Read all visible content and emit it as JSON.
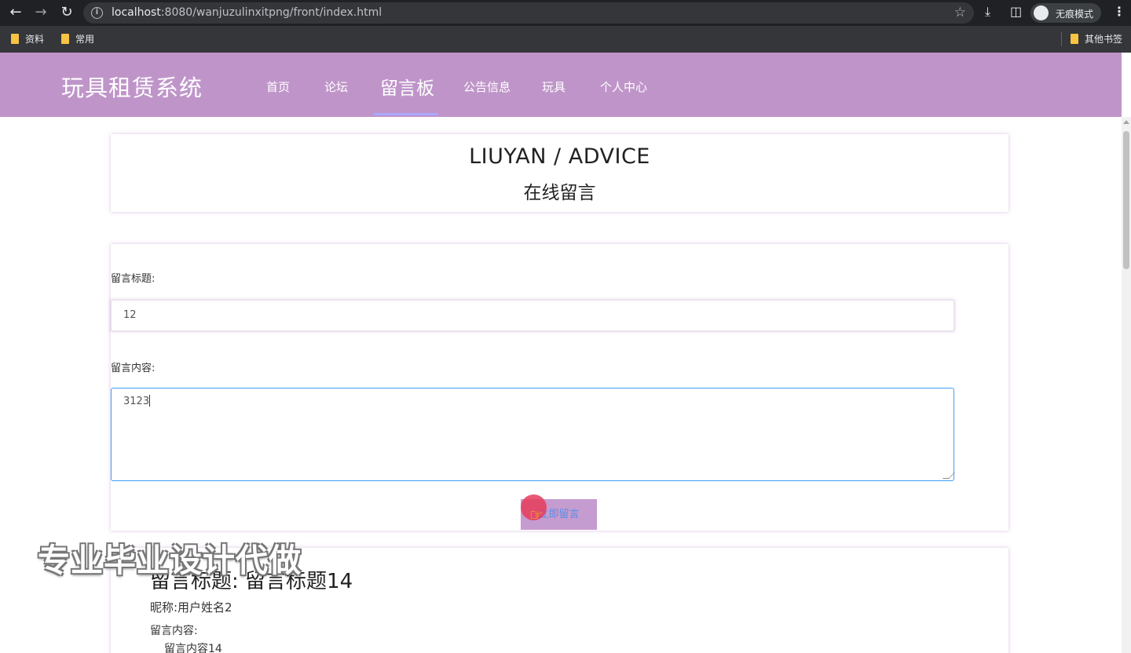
{
  "browser": {
    "back_icon": "arrow-left-icon",
    "forward_icon": "arrow-right-icon",
    "reload_icon": "reload-icon",
    "url_host": "localhost",
    "url_path": ":8080/wanjuzulinxitpng/front/index.html",
    "incognito_label": "无痕模式",
    "bookmarks": [
      "资料",
      "常用"
    ],
    "other_bookmarks": "其他书签"
  },
  "site": {
    "logo": "玩具租赁系统",
    "nav": [
      "首页",
      "论坛",
      "留言板",
      "公告信息",
      "玩具",
      "个人中心"
    ],
    "active_nav": "留言板",
    "header_color": "#bf95c9"
  },
  "heading": {
    "en": "LIUYAN / ADVICE",
    "cn": "在线留言"
  },
  "form": {
    "title_label": "留言标题:",
    "title_value": "12",
    "content_label": "留言内容:",
    "content_value": "3123",
    "submit_label": "立即留言"
  },
  "messages": [
    {
      "title": "留言标题:  留言标题14",
      "nickname": "昵称:用户姓名2",
      "content_label": "留言内容:",
      "content": "留言内容14"
    }
  ],
  "watermark": "专业毕业设计代做"
}
